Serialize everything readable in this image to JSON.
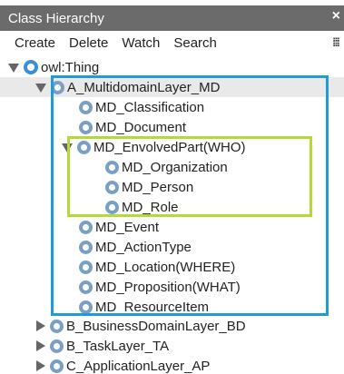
{
  "title": "Class Hierarchy",
  "close_icon": "×",
  "toolbar": {
    "create": "Create",
    "delete": "Delete",
    "watch": "Watch",
    "search": "Search",
    "settings_icon": "settings-sliders-icon"
  },
  "tree": {
    "root": "owl:Thing",
    "a_layer": "A_MultidomainLayer_MD",
    "md_classification": "MD_Classification",
    "md_document": "MD_Document",
    "md_envolved": "MD_EnvolvedPart(WHO)",
    "md_organization": "MD_Organization",
    "md_person": "MD_Person",
    "md_role": "MD_Role",
    "md_event": "MD_Event",
    "md_actiontype": "MD_ActionType",
    "md_location": "MD_Location(WHERE)",
    "md_proposition": "MD_Proposition(WHAT)",
    "md_resourceitem": "MD_ResourceItem",
    "b_layer": "B_BusinessDomainLayer_BD",
    "b_task": "B_TaskLayer_TA",
    "c_layer": "C_ApplicationLayer_AP"
  },
  "colors": {
    "titlebar": "#6b6b6b",
    "class_icon": "#7a9fc7",
    "highlight_blue": "#1e9bd8",
    "highlight_green": "#b6d93a",
    "selection": "#e9e9e9"
  }
}
